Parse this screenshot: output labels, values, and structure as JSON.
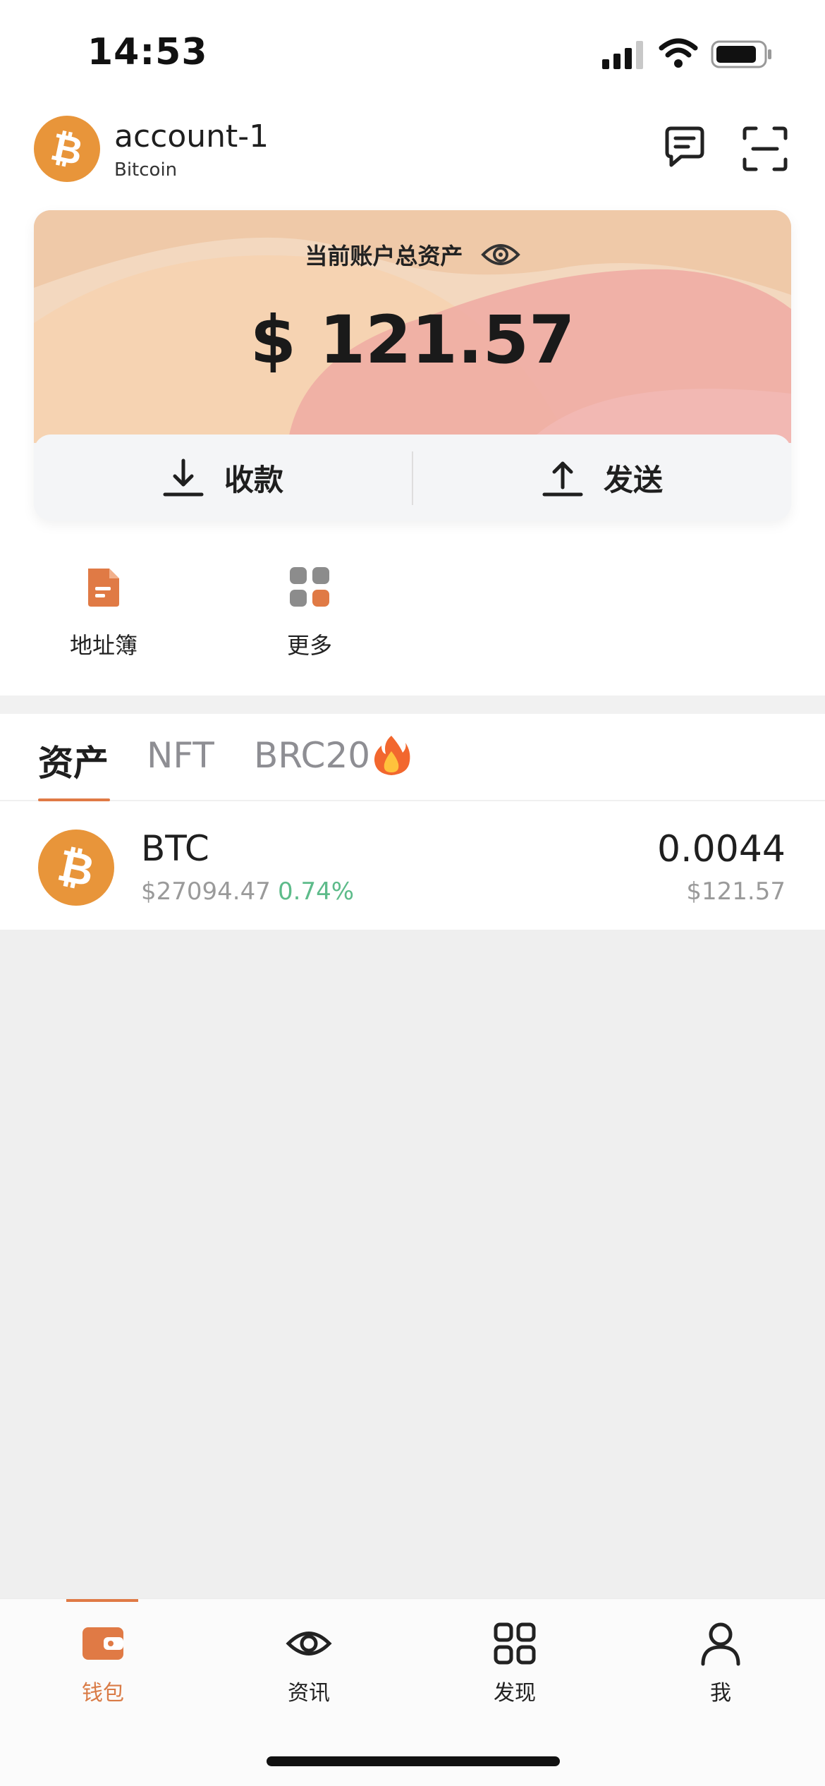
{
  "status_bar": {
    "time": "14:53"
  },
  "header": {
    "account_name": "account-1",
    "chain": "Bitcoin"
  },
  "balance_card": {
    "title": "当前账户总资产",
    "amount": "$ 121.57",
    "receive_label": "收款",
    "send_label": "发送"
  },
  "shortcuts": {
    "address_book": "地址簿",
    "more": "更多"
  },
  "tabs": [
    "资产",
    "NFT",
    "BRC20"
  ],
  "assets": [
    {
      "symbol": "BTC",
      "price": "$27094.47",
      "change": "0.74%",
      "amount": "0.0044",
      "value": "$121.57"
    }
  ],
  "bottom_nav": [
    "钱包",
    "资讯",
    "发现",
    "我"
  ],
  "colors": {
    "accent": "#e07a45",
    "bitcoin": "#e8953a",
    "positive": "#5dbb8a"
  }
}
